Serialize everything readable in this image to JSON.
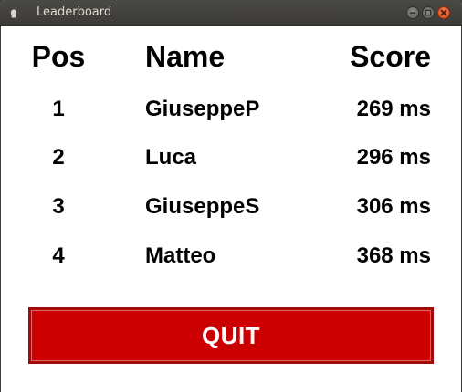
{
  "window": {
    "title": "Leaderboard"
  },
  "table": {
    "headers": {
      "pos": "Pos",
      "name": "Name",
      "score": "Score"
    },
    "rows": [
      {
        "pos": "1",
        "name": "GiuseppeP",
        "score": "269 ms"
      },
      {
        "pos": "2",
        "name": "Luca",
        "score": "296 ms"
      },
      {
        "pos": "3",
        "name": "GiuseppeS",
        "score": "306 ms"
      },
      {
        "pos": "4",
        "name": "Matteo",
        "score": "368 ms"
      }
    ]
  },
  "quit_button": {
    "label": "QUIT"
  },
  "colors": {
    "quit_background": "#cc0000",
    "titlebar": "#3c3b37",
    "close_button": "#e05a2a"
  }
}
